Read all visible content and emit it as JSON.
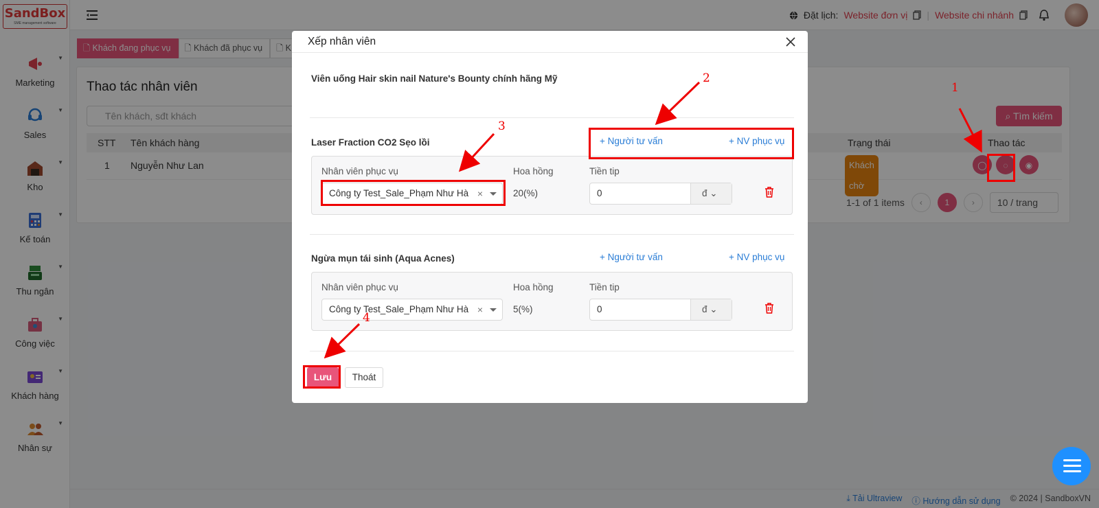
{
  "app": {
    "logo_text": "SandBox",
    "logo_tagline": "SME management software"
  },
  "sidebar": {
    "items": [
      {
        "label": "Marketing",
        "icon": "megaphone-icon",
        "color": "#e0404f"
      },
      {
        "label": "Sales",
        "icon": "headset-icon",
        "color": "#2a7dd6"
      },
      {
        "label": "Kho",
        "icon": "warehouse-icon",
        "color": "#a04a2e"
      },
      {
        "label": "Kế toán",
        "icon": "calculator-icon",
        "color": "#3a6ed6"
      },
      {
        "label": "Thu ngân",
        "icon": "cash-register-icon",
        "color": "#2e8a3a"
      },
      {
        "label": "Công việc",
        "icon": "briefcase-icon",
        "color": "#d65a7a"
      },
      {
        "label": "Khách hàng",
        "icon": "id-card-icon",
        "color": "#7a4ad6"
      },
      {
        "label": "Nhân sự",
        "icon": "people-icon",
        "color": "#e08a2e"
      }
    ]
  },
  "header": {
    "booking_label": "Đặt lịch:",
    "website_unit": "Website đơn vị",
    "website_branch": "Website chi nhánh"
  },
  "tabs": [
    "Khách đang phục vụ",
    "Khách đã phục vụ",
    "K"
  ],
  "panel": {
    "title": "Thao tác nhân viên",
    "search_placeholder": "Tên khách, sđt khách",
    "search_button": "Tìm kiếm",
    "columns": {
      "stt": "STT",
      "name": "Tên khách hàng",
      "status": "Trạng thái",
      "actions": "Thao tác"
    },
    "rows": [
      {
        "stt": "1",
        "name": "Nguyễn Như Lan",
        "status": "Khách chờ"
      }
    ],
    "pagination": {
      "summary": "1-1 of 1 items",
      "current": "1",
      "page_size": "10 / trang"
    }
  },
  "footer": {
    "ultraview": "Tải Ultraview",
    "guide": "Hướng dẫn sử dụng",
    "copyright": "© 2024 | SandboxVN"
  },
  "modal": {
    "title": "Xếp nhân viên",
    "product_title": "Viên uống Hair skin nail Nature's Bounty chính hãng Mỹ",
    "add_consultant": "Người tư vấn",
    "add_staff": "NV phục vụ",
    "field_staff": "Nhân viên phục vụ",
    "field_commission": "Hoa hồng",
    "field_tip": "Tiền tip",
    "services": [
      {
        "name": "Laser Fraction CO2 Sẹo lồi",
        "staff": "Công ty Test_Sale_Phạm Như Hà",
        "commission": "20(%)",
        "tip": "0",
        "currency": "đ"
      },
      {
        "name": "Ngừa mụn tái sinh (Aqua Acnes)",
        "staff": "Công ty Test_Sale_Phạm Như Hà",
        "commission": "5(%)",
        "tip": "0",
        "currency": "đ"
      }
    ],
    "save_button": "Lưu",
    "exit_button": "Thoát"
  },
  "annotations": [
    "1",
    "2",
    "3",
    "4"
  ]
}
